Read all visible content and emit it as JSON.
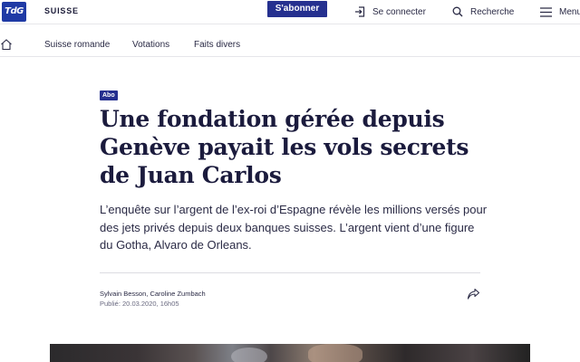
{
  "header": {
    "logo_text": "TdG",
    "section": "SUISSE",
    "subscribe_label": "S'abonner",
    "login_label": "Se connecter",
    "search_label": "Recherche",
    "menu_label": "Menu",
    "icons": {
      "login": "login-icon",
      "search": "search-icon",
      "menu": "menu-icon"
    },
    "brand_color": "#25308f"
  },
  "subnav": {
    "home_icon": "home-icon",
    "items": [
      {
        "label": "Suisse romande"
      },
      {
        "label": "Votations"
      },
      {
        "label": "Faits divers"
      }
    ]
  },
  "article": {
    "badge": "Abo",
    "headline": "Une fondation gérée depuis Genève payait les vols secrets de Juan Carlos",
    "lead": "L’enquête sur l’argent de l’ex-roi d’Espagne révèle les millions versés pour des jets privés depuis deux banques suisses. L’argent vient d’une figure du Gotha, Alvaro de Orleans.",
    "authors": "Sylvain Besson, Caroline Zumbach",
    "published": "Publié: 20.03.2020, 16h05",
    "share_icon": "share-icon"
  }
}
